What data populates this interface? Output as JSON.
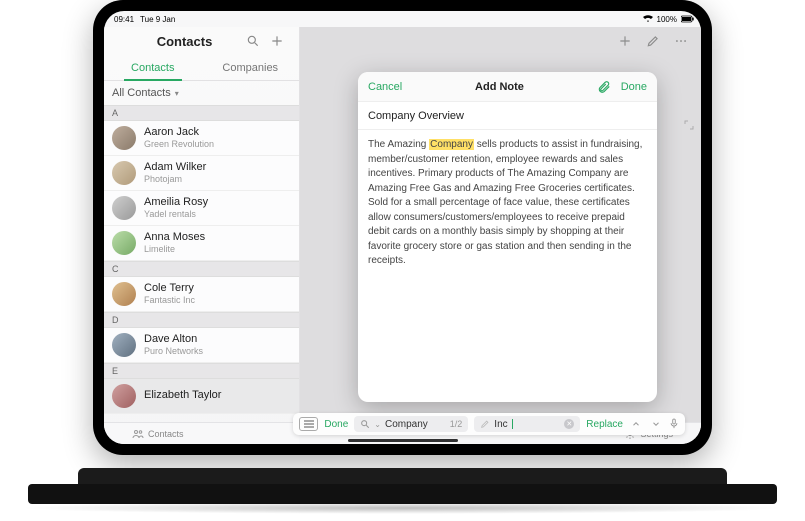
{
  "status": {
    "time": "09:41",
    "date": "Tue 9 Jan",
    "battery": "100%"
  },
  "sidebar": {
    "title": "Contacts",
    "tabs": {
      "contacts": "Contacts",
      "companies": "Companies"
    },
    "filter": "All Contacts",
    "sections": {
      "A": [
        {
          "name": "Aaron Jack",
          "sub": "Green Revolution"
        },
        {
          "name": "Adam Wilker",
          "sub": "Photojam"
        },
        {
          "name": "Ameilia Rosy",
          "sub": "Yadel rentals"
        },
        {
          "name": "Anna Moses",
          "sub": "Limelite"
        }
      ],
      "C": [
        {
          "name": "Cole Terry",
          "sub": "Fantastic Inc"
        }
      ],
      "D": [
        {
          "name": "Dave Alton",
          "sub": "Puro Networks"
        }
      ],
      "E": [
        {
          "name": "Elizabeth Taylor",
          "sub": ""
        }
      ]
    }
  },
  "modal": {
    "cancel": "Cancel",
    "title": "Add Note",
    "done": "Done",
    "subject": "Company Overview",
    "body_pre": "The Amazing ",
    "highlight": "Company",
    "body_post": " sells products to assist in fundraising, member/customer retention, employee rewards and sales incentives.  Primary products of The Amazing Company are Amazing Free Gas and Amazing Free Groceries certificates.  Sold for a small percentage of face value, these certificates allow consumers/customers/employees to receive prepaid debit cards on a monthly basis simply by shopping at their favorite grocery store or gas station and then sending in the receipts."
  },
  "findbar": {
    "done": "Done",
    "search_value": "Company",
    "count": "1/2",
    "replace_value": "Inc",
    "replace_btn": "Replace"
  },
  "bottombar": {
    "contacts": "Contacts",
    "settings": "Settings"
  }
}
